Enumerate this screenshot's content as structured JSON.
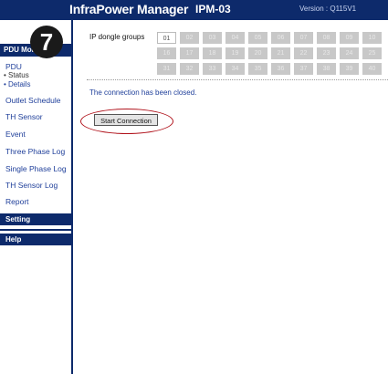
{
  "header": {
    "title": "InfraPower Manager",
    "device": "IPM-03",
    "version": "Version : Q115V1"
  },
  "badge": {
    "number": "7"
  },
  "sidebar": {
    "heading": "PDU Mon",
    "pdu_label": "PDU",
    "sub_items": [
      "• Status",
      "• Details"
    ],
    "links": [
      "Outlet Schedule",
      "TH Sensor",
      "Event",
      "Three Phase Log",
      "Single Phase Log",
      "TH Sensor Log",
      "Report"
    ],
    "setting": "Setting",
    "help": "Help"
  },
  "main": {
    "groups_label": "IP dongle groups",
    "group_cells": [
      "01",
      "02",
      "03",
      "04",
      "05",
      "06",
      "07",
      "08",
      "09",
      "10",
      "16",
      "17",
      "18",
      "19",
      "20",
      "21",
      "22",
      "23",
      "24",
      "25",
      "31",
      "32",
      "33",
      "34",
      "35",
      "36",
      "37",
      "38",
      "39",
      "40"
    ],
    "selected_group": "01",
    "message": "The connection has been closed.",
    "start_button": "Start Connection"
  },
  "colors": {
    "navy": "#0d2a6b",
    "link": "#1f3f9a",
    "cell_disabled": "#c8c8c8",
    "highlight_ring": "#b0121b"
  }
}
